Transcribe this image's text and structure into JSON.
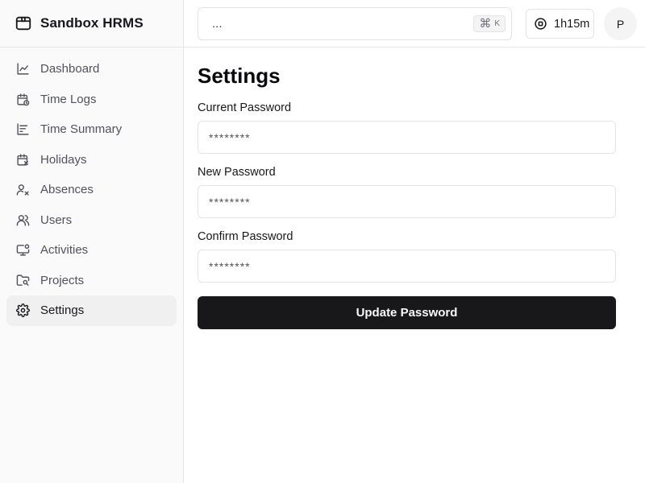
{
  "app": {
    "name": "Sandbox HRMS",
    "icon": "package-box-icon"
  },
  "sidebar": {
    "items": [
      {
        "label": "Dashboard",
        "icon": "line-chart-icon",
        "active": false
      },
      {
        "label": "Time Logs",
        "icon": "calendar-clock-icon",
        "active": false
      },
      {
        "label": "Time Summary",
        "icon": "bar-chart-icon",
        "active": false
      },
      {
        "label": "Holidays",
        "icon": "calendar-x-icon",
        "active": false
      },
      {
        "label": "Absences",
        "icon": "user-x-icon",
        "active": false
      },
      {
        "label": "Users",
        "icon": "users-icon",
        "active": false
      },
      {
        "label": "Activities",
        "icon": "monitor-cog-icon",
        "active": false
      },
      {
        "label": "Projects",
        "icon": "folder-search-icon",
        "active": false
      },
      {
        "label": "Settings",
        "icon": "gear-icon",
        "active": true
      }
    ]
  },
  "header": {
    "search": {
      "text": "...",
      "shortcut_symbol": "⌘",
      "shortcut_key": "K"
    },
    "timer": {
      "text": "1h15m",
      "icon": "stop-circle-icon"
    },
    "avatar": {
      "initial": "P"
    }
  },
  "main": {
    "title": "Settings",
    "fields": [
      {
        "label": "Current Password",
        "placeholder": "********"
      },
      {
        "label": "New Password",
        "placeholder": "********"
      },
      {
        "label": "Confirm Password",
        "placeholder": "********"
      }
    ],
    "submit_label": "Update Password"
  },
  "colors": {
    "primary": "#18181b",
    "border": "#e4e4e7",
    "sidebar_bg": "#fafafa",
    "muted_text": "#52525b"
  }
}
